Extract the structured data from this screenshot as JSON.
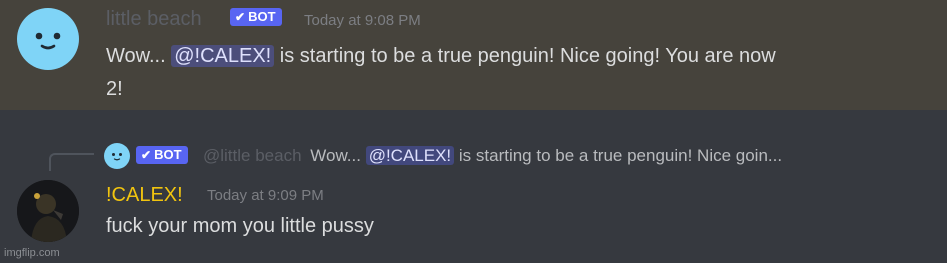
{
  "message1": {
    "author": "little beach",
    "author_color": "#5b5e65",
    "badge": "BOT",
    "timestamp": "Today at 9:08 PM",
    "text_before": "Wow...",
    "mention": "@!CALEX!",
    "text_line1_after": "is starting to be a true penguin! Nice going! You are now",
    "text_line2": "2!"
  },
  "reply": {
    "badge": "BOT",
    "author": "@little beach",
    "text_before": "Wow...",
    "mention": "@!CALEX!",
    "text_after": "is starting to be a true penguin! Nice goin..."
  },
  "message2": {
    "author": "!CALEX!",
    "author_color": "#f1c40f",
    "timestamp": "Today at 9:09 PM",
    "text": "fuck your mom you little pussy"
  },
  "watermark": "imgflip.com",
  "colors": {
    "highlight_bg": "#46433c",
    "chat_bg": "#36393f",
    "bot_badge": "#5865f2",
    "mention_bg": "#5865f259"
  }
}
